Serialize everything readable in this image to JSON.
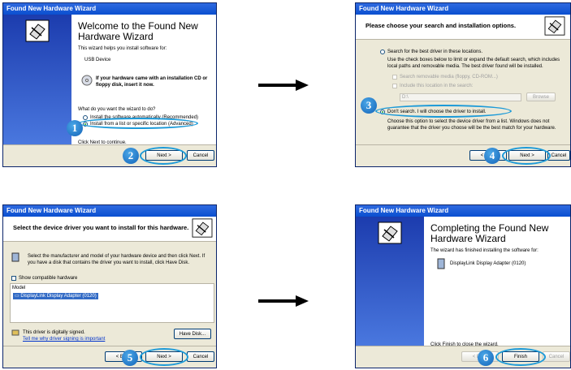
{
  "arrows": [
    "right-arrow-icon",
    "right-arrow-icon"
  ],
  "accent_color": "#1c9ad8",
  "step1": {
    "title": "Found New Hardware Wizard",
    "heading": "Welcome to the Found New Hardware Wizard",
    "intro": "This wizard helps you install software for:",
    "device": "USB Device",
    "cd_hint": "If your hardware came with an installation CD or floppy disk, insert it now.",
    "question": "What do you want the wizard to do?",
    "option_auto": "Install the software automatically (Recommended)",
    "option_manual": "Install from a list or specific location (Advanced)",
    "continue_hint": "Click Next to continue.",
    "btn_next": "Next >",
    "btn_cancel": "Cancel",
    "badge_a": "1",
    "badge_b": "2"
  },
  "step2": {
    "title": "Found New Hardware Wizard",
    "header": "Please choose your search and installation options.",
    "opt_search": "Search for the best driver in these locations.",
    "search_desc": "Use the check boxes below to limit or expand the default search, which includes local paths and removable media. The best driver found will be installed.",
    "chk_removable": "Search removable media (floppy, CD-ROM...)",
    "chk_include": "Include this location in the search:",
    "path_value": "D:\\",
    "btn_browse": "Browse",
    "opt_dont_search": "Don't search. I will choose the driver to install.",
    "dont_search_desc": "Choose this option to select the device driver from a list. Windows does not guarantee that the driver you choose will be the best match for your hardware.",
    "btn_back": "< Back",
    "btn_next": "Next >",
    "btn_cancel": "Cancel",
    "badge_a": "3",
    "badge_b": "4"
  },
  "step3": {
    "title": "Found New Hardware Wizard",
    "header": "Select the device driver you want to install for this hardware.",
    "instruction": "Select the manufacturer and model of your hardware device and then click Next. If you have a disk that contains the driver you want to install, click Have Disk.",
    "chk_compatible": "Show compatible hardware",
    "model_header": "Model",
    "model_item": "DisplayLink Display Adapter (0120)",
    "signed_text": "This driver is digitally signed.",
    "signing_link": "Tell me why driver signing is important",
    "btn_have_disk": "Have Disk...",
    "btn_back": "< Back",
    "btn_next": "Next >",
    "btn_cancel": "Cancel",
    "badge": "5"
  },
  "step4": {
    "title": "Found New Hardware Wizard",
    "heading": "Completing the Found New Hardware Wizard",
    "finished_text": "The wizard has finished installing the software for:",
    "device": "DisplayLink Display Adapter (0120)",
    "close_hint": "Click Finish to close the wizard.",
    "btn_back": "< Back",
    "btn_finish": "Finish",
    "btn_cancel": "Cancel",
    "badge": "6"
  }
}
